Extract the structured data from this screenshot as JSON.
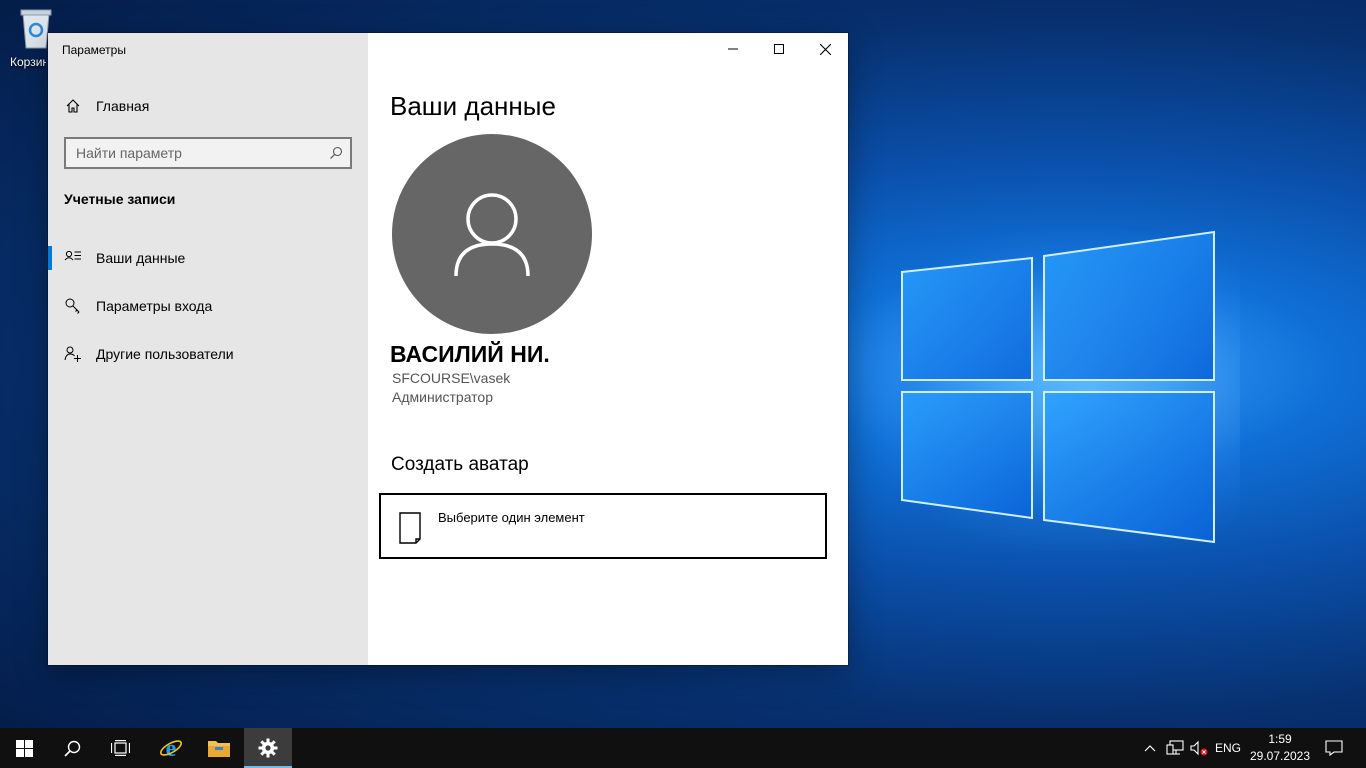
{
  "desktop": {
    "recycle_bin_label": "Корзина"
  },
  "window": {
    "title": "Параметры",
    "minimize_icon": "minimize-icon",
    "maximize_icon": "maximize-icon",
    "close_icon": "close-icon"
  },
  "sidebar": {
    "home_label": "Главная",
    "search_placeholder": "Найти параметр",
    "section_title": "Учетные записи",
    "items": [
      {
        "label": "Ваши данные",
        "icon": "user-info-icon",
        "active": true
      },
      {
        "label": "Параметры входа",
        "icon": "key-icon",
        "active": false
      },
      {
        "label": "Другие пользователи",
        "icon": "add-user-icon",
        "active": false
      }
    ]
  },
  "content": {
    "page_title": "Ваши данные",
    "user_name": "ВАСИЛИЙ НИ.",
    "account": "SFCOURSE\\vasek",
    "role": "Администратор",
    "avatar_section_title": "Создать аватар",
    "browse_label": "Выберите один элемент"
  },
  "taskbar": {
    "language": "ENG",
    "time": "1:59",
    "date": "29.07.2023",
    "accent_color": "#76b9ed"
  },
  "colors": {
    "accent": "#0078d7",
    "sidebar_bg": "#e6e6e6",
    "avatar_bg": "#666666"
  }
}
